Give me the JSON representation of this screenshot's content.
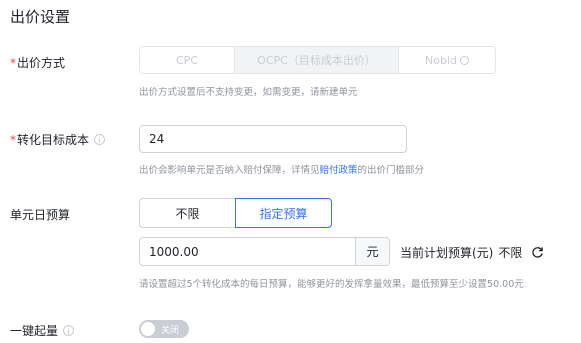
{
  "section_title": "出价设置",
  "bid_mode": {
    "label": "出价方式",
    "required_mark": "*",
    "options": [
      "CPC",
      "OCPC（目标成本出价）",
      "Nobid"
    ],
    "selected": "OCPC（目标成本出价）",
    "hint": "出价方式设置后不支持变更，如需变更，请新建单元"
  },
  "target_cost": {
    "label": "转化目标成本",
    "required_mark": "*",
    "value": "24",
    "hint_before": "出价会影响单元是否纳入赔付保障，详情见",
    "hint_link": "赔付政策",
    "hint_after": "的出价门槛部分"
  },
  "daily_budget": {
    "label": "单元日预算",
    "options": [
      "不限",
      "指定预算"
    ],
    "selected": "指定预算",
    "value": "1000.00",
    "unit": "元",
    "plan_budget_label": "当前计划预算(元)",
    "plan_budget_value": "不限",
    "hint": "请设置超过5个转化成本的每日预算，能够更好的发挥拿量效果，最低预算至少设置50.00元"
  },
  "one_click": {
    "label": "一键起量",
    "switch_text": "关闭",
    "enabled": false
  },
  "colors": {
    "accent": "#3370ff",
    "required": "#f54a45",
    "hint": "#8f959e"
  }
}
